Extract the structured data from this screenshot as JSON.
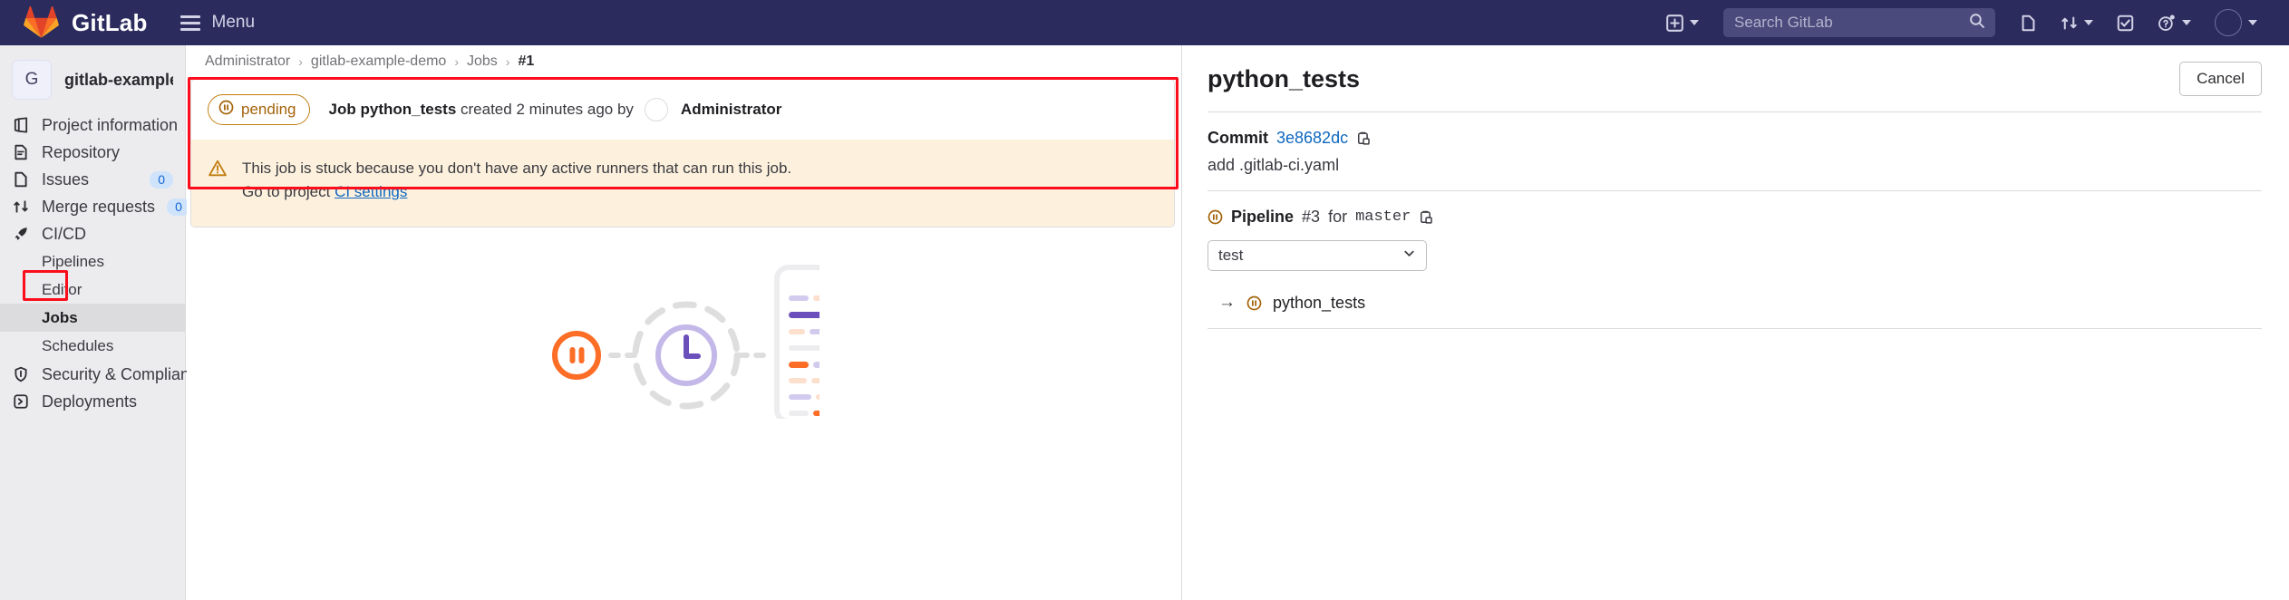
{
  "navbar": {
    "brand": "GitLab",
    "menu_label": "Menu",
    "logo_icon": "gitlab-logo-icon",
    "hamburger_icon": "hamburger-menu-icon",
    "icons": {
      "plus": "plus-square-icon",
      "search": "search-icon",
      "issues": "issues-icon",
      "merge_requests": "merge-request-icon",
      "todos": "todo-check-icon",
      "help": "help-question-icon",
      "avatar": "user-avatar-icon"
    },
    "search_placeholder": "Search GitLab"
  },
  "sidebar": {
    "project_initial": "G",
    "project_name": "gitlab-example-demo",
    "items": [
      {
        "label": "Project information",
        "icon": "project-information-icon",
        "badge": ""
      },
      {
        "label": "Repository",
        "icon": "repository-icon",
        "badge": ""
      },
      {
        "label": "Issues",
        "icon": "issues-icon",
        "badge": "0"
      },
      {
        "label": "Merge requests",
        "icon": "merge-request-icon",
        "badge": "0"
      },
      {
        "label": "CI/CD",
        "icon": "rocket-icon",
        "badge": ""
      }
    ],
    "subitems": [
      {
        "label": "Pipelines"
      },
      {
        "label": "Editor"
      },
      {
        "label": "Jobs"
      },
      {
        "label": "Schedules"
      }
    ],
    "items_bottom": [
      {
        "label": "Security & Compliance",
        "icon": "shield-icon"
      },
      {
        "label": "Deployments",
        "icon": "deployments-icon"
      }
    ],
    "active_subitem": "Jobs"
  },
  "breadcrumb": {
    "items": [
      "Administrator",
      "gitlab-example-demo",
      "Jobs"
    ],
    "current": "#1",
    "separator": "›"
  },
  "job": {
    "status_badge": "pending",
    "status_icon": "status-pending-icon",
    "title_prefix": "Job",
    "job_name": "python_tests",
    "created_text": "created 2 minutes ago by",
    "author": "Administrator",
    "alert": {
      "icon": "warning-triangle-icon",
      "line1": "This job is stuck because you don't have any active runners that can run this job.",
      "line2_prefix": "Go to project",
      "line2_link": "CI settings"
    }
  },
  "illustration": {
    "pause_icon": "pause-circle-icon",
    "clock_icon": "clock-dashed-icon",
    "document_icon": "code-document-icon"
  },
  "right_panel": {
    "title": "python_tests",
    "cancel_label": "Cancel",
    "commit_label": "Commit",
    "commit_sha": "3e8682dc",
    "commit_copy_icon": "copy-to-clipboard-icon",
    "commit_message": "add .gitlab-ci.yaml",
    "pipeline_icon": "status-pending-icon",
    "pipeline_label": "Pipeline",
    "pipeline_number": "#3",
    "pipeline_for": "for",
    "pipeline_ref": "master",
    "pipeline_copy_icon": "copy-to-clipboard-icon",
    "stage_selected": "test",
    "stage_chevron_icon": "chevron-down-icon",
    "jobs": [
      {
        "arrow": "→",
        "icon": "status-pending-icon",
        "name": "python_tests"
      }
    ]
  },
  "colors": {
    "navbar_bg": "#2b2b5e",
    "pending_orange": "#a4630a",
    "alert_bg": "#fdf1dd",
    "link_blue": "#1068bf",
    "annotation_red": "#fc0d1b",
    "illus_orange": "#fc6d26",
    "illus_purple": "#6b4fbb"
  }
}
